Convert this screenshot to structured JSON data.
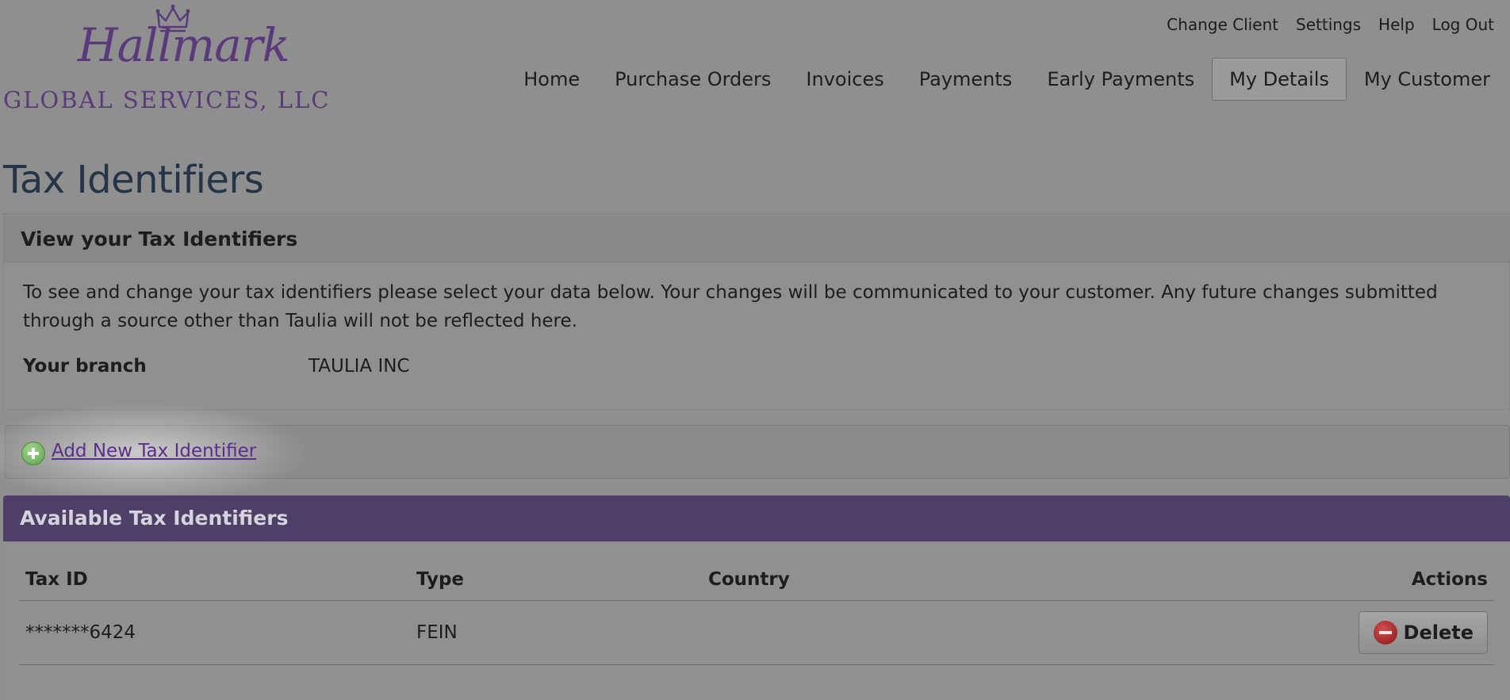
{
  "brand": {
    "script_name": "Hallmark",
    "company_line": "GLOBAL SERVICES, LLC",
    "crown_icon": "crown-icon",
    "brand_color": "#5b3a7c"
  },
  "utility_nav": [
    "Change Client",
    "Settings",
    "Help",
    "Log Out"
  ],
  "main_nav": {
    "items": [
      "Home",
      "Purchase Orders",
      "Invoices",
      "Payments",
      "Early Payments",
      "My Details",
      "My Customer"
    ],
    "active": "My Details"
  },
  "page": {
    "title": "Tax Identifiers"
  },
  "info_panel": {
    "heading": "View your Tax Identifiers",
    "description": "To see and change your tax identifiers please select your data below. Your changes will be communicated to your customer. Any future changes submitted through a source other than Taulia will not be reflected here.",
    "branch_label": "Your branch",
    "branch_value": "TAULIA INC"
  },
  "add_action": {
    "label": "Add New Tax Identifier",
    "icon": "plus-circle-icon"
  },
  "table": {
    "heading": "Available Tax Identifiers",
    "header_color": "#4d3f66",
    "columns": [
      "Tax ID",
      "Type",
      "Country",
      "Actions"
    ],
    "rows": [
      {
        "tax_id": "*******6424",
        "type": "FEIN",
        "country": "",
        "action_label": "Delete"
      }
    ]
  }
}
